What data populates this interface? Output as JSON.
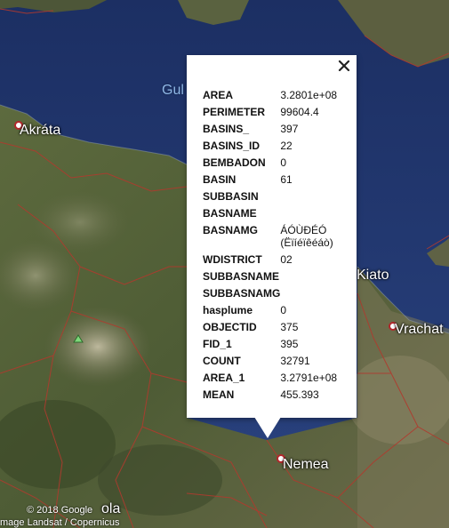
{
  "map": {
    "places": {
      "akrata": "Akráta",
      "kiato": "Kiato",
      "vrachati": "Vrachat",
      "nemea": "Nemea",
      "gulf": "Gul",
      "bottom_left": "ola"
    },
    "attribution": {
      "copyright": "© 2018 Google",
      "imagery": "mage Landsat / Copernicus"
    }
  },
  "popup": {
    "close_icon": "close-icon",
    "rows": [
      {
        "key": "AREA",
        "value": "3.2801e+08"
      },
      {
        "key": "PERIMETER",
        "value": "99604.4"
      },
      {
        "key": "BASINS_",
        "value": "397"
      },
      {
        "key": "BASINS_ID",
        "value": "22"
      },
      {
        "key": "BEMBADON",
        "value": "0"
      },
      {
        "key": "BASIN",
        "value": "61"
      },
      {
        "key": "SUBBASIN",
        "value": ""
      },
      {
        "key": "BASNAME",
        "value": ""
      },
      {
        "key": "BASNAMG",
        "value": "ÁÓÙÐÉÓ (Ëïíéïêéáò)"
      },
      {
        "key": "WDISTRICT",
        "value": "02"
      },
      {
        "key": "SUBBASNAME",
        "value": ""
      },
      {
        "key": "SUBBASNAMG",
        "value": ""
      },
      {
        "key": "hasplume",
        "value": "0"
      },
      {
        "key": "OBJECTID",
        "value": "375"
      },
      {
        "key": "FID_1",
        "value": "395"
      },
      {
        "key": "COUNT",
        "value": "32791"
      },
      {
        "key": "AREA_1",
        "value": "3.2791e+08"
      },
      {
        "key": "MEAN",
        "value": "455.393"
      }
    ]
  }
}
